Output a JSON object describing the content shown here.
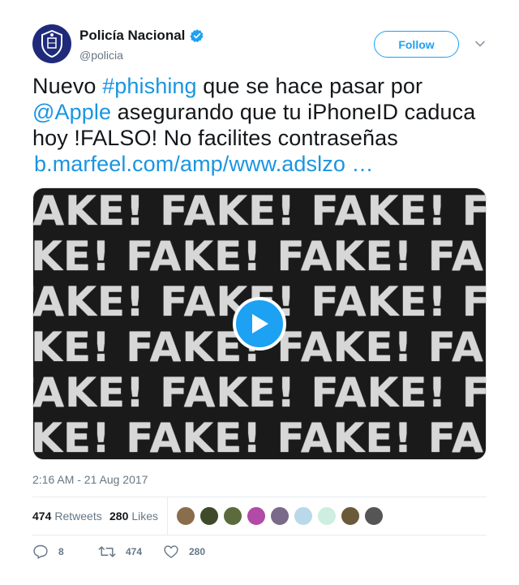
{
  "user": {
    "display_name": "Policía Nacional",
    "handle": "@policia",
    "verified": true
  },
  "follow_label": "Follow",
  "text": {
    "t1": "Nuevo ",
    "hashtag": "#phishing",
    "t2": " que se hace pasar por ",
    "mention": "@Apple",
    "t3": " asegurando que tu iPhoneID caduca hoy !FALSO! No facilites contraseñas ",
    "url": "b.marfeel.com/amp/www.adslzo …"
  },
  "media": {
    "overlay_text": "FAKE!",
    "type": "video"
  },
  "timestamp": "2:16 AM - 21 Aug 2017",
  "stats": {
    "retweets_count": "474",
    "retweets_label": "Retweets",
    "likes_count": "280",
    "likes_label": "Likes"
  },
  "actions": {
    "replies": "8",
    "retweets": "474",
    "likes": "280"
  },
  "colors": {
    "accent": "#1da1f2",
    "link": "#1b95e0",
    "muted": "#657786",
    "liker_avatars": [
      "#8a6d4b",
      "#3f4a2a",
      "#5c6b3c",
      "#b24aa8",
      "#7a6a8a",
      "#b9d9ea",
      "#cdeee0",
      "#6b5a3a",
      "#555555"
    ]
  }
}
